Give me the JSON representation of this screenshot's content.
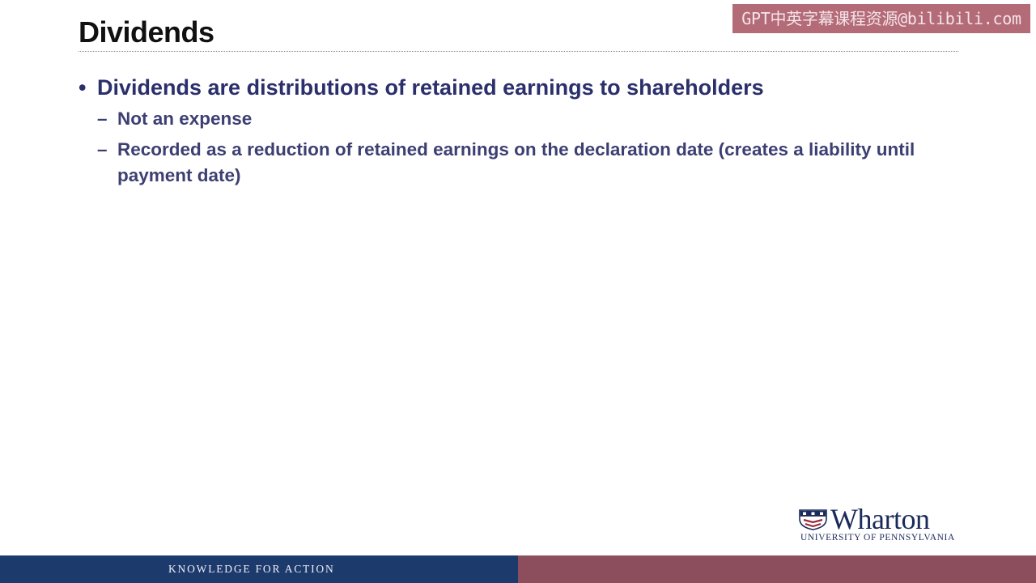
{
  "slide": {
    "title": "Dividends",
    "watermark": "GPT中英字幕课程资源@bilibili.com",
    "bullets": [
      {
        "text": "Dividends are distributions of retained earnings to shareholders",
        "sub_items": [
          "Not an expense",
          "Recorded as a reduction of retained earnings on the declaration date (creates a liability until payment date)"
        ]
      }
    ]
  },
  "logo": {
    "name": "Wharton",
    "subtitle": "University of Pennsylvania"
  },
  "footer": {
    "tagline": "KNOWLEDGE FOR ACTION"
  },
  "colors": {
    "footer_blue": "#1d3a6d",
    "footer_maroon": "#8c4e5c",
    "bullet_text": "#2b2f6b",
    "watermark_bg": "#b46b78"
  }
}
